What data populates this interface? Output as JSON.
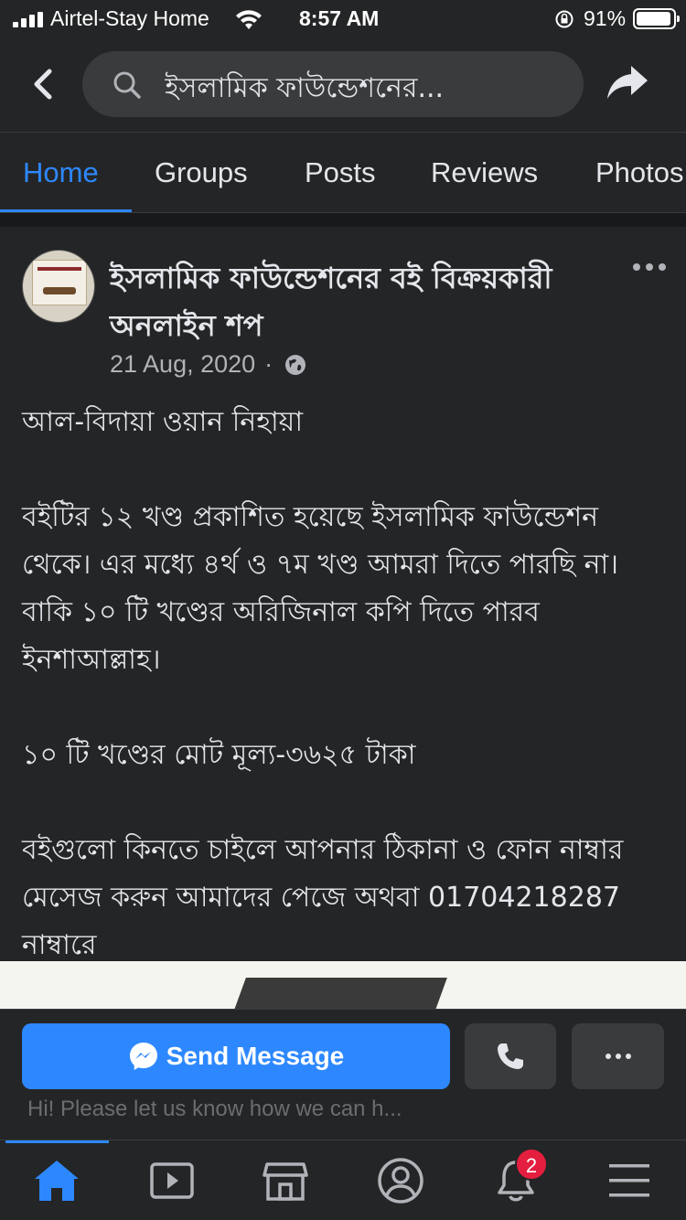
{
  "status_bar": {
    "carrier": "Airtel-Stay Home",
    "time": "8:57 AM",
    "battery": "91%",
    "icons": [
      "signal-icon",
      "wifi-icon",
      "orientation-lock-icon",
      "battery-icon"
    ]
  },
  "topnav": {
    "search_text": "ইসলামিক ফাউন্ডেশনের...",
    "icons": [
      "back-arrow-icon",
      "search-icon",
      "share-icon"
    ]
  },
  "tabs": [
    {
      "label": "Home",
      "active": true
    },
    {
      "label": "Groups",
      "active": false
    },
    {
      "label": "Posts",
      "active": false
    },
    {
      "label": "Reviews",
      "active": false
    },
    {
      "label": "Photos",
      "active": false
    }
  ],
  "post": {
    "page_name": "ইসলামিক ফাউন্ডেশনের বই বিক্রয়কারী অনলাইন শপ",
    "date": "21 Aug, 2020",
    "meta_separator": "·",
    "privacy_icon": "globe-icon",
    "paragraphs": [
      "আল-বিদায়া ওয়ান নিহায়া",
      "বইটির ১২ খণ্ড প্রকাশিত হয়েছে ইসলামিক ফাউন্ডেশন থেকে। এর মধ্যে ৪র্থ ও ৭ম খণ্ড আমরা দিতে পারছি না। বাকি ১০ টি খণ্ডের অরিজিনাল কপি দিতে পারব ইনশাআল্লাহ।",
      "১০ টি খণ্ডের মোট মূল্য-৩৬২৫ টাকা",
      "বইগুলো কিনতে চাইলে আপনার ঠিকানা ও ফোন নাম্বার মেসেজ করুন আমাদের পেজে অথবা 01704218287 নাম্বারে"
    ]
  },
  "actions": {
    "send_label": "Send Message",
    "hint": "Hi! Please let us know how we can h...",
    "icons": [
      "messenger-icon",
      "phone-icon",
      "more-icon"
    ]
  },
  "bottom_nav": {
    "items": [
      "home-icon",
      "watch-icon",
      "marketplace-icon",
      "profile-icon",
      "notifications-icon",
      "menu-icon"
    ],
    "notification_count": "2"
  },
  "colors": {
    "accent": "#2d88ff",
    "background": "#18191a",
    "surface": "#242526",
    "badge": "#e41e3f"
  }
}
